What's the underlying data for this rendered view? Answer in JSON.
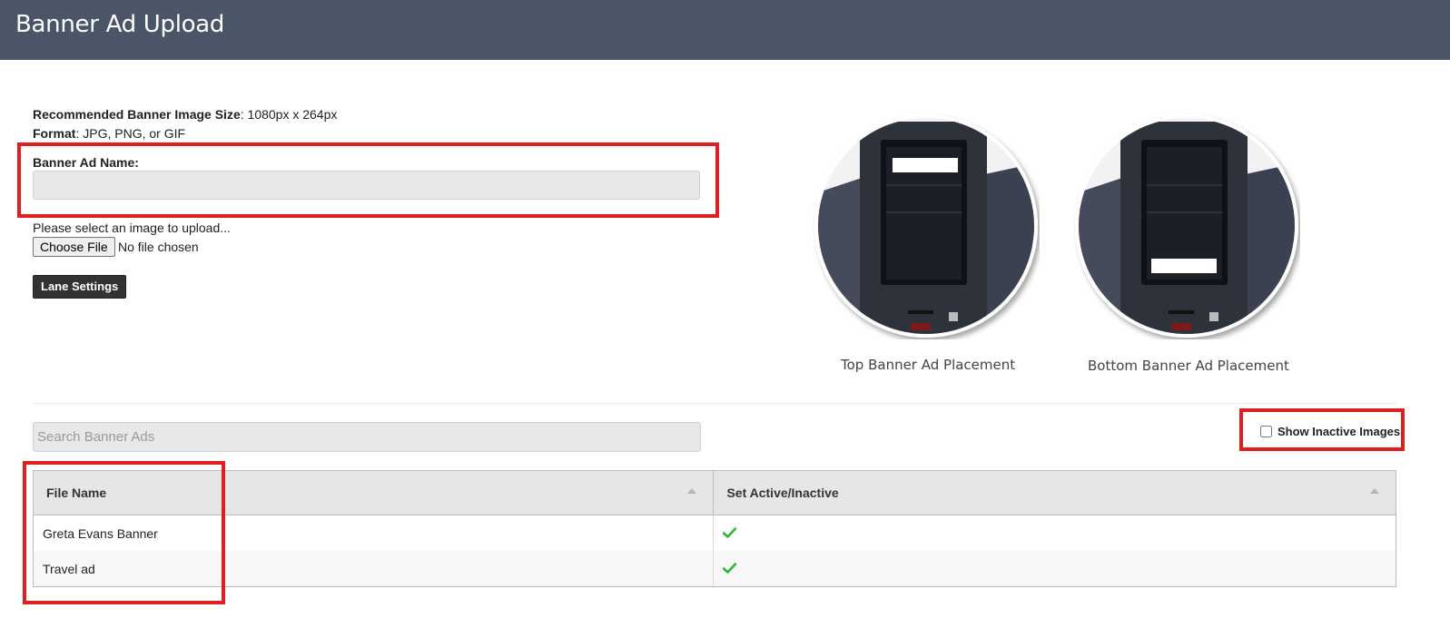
{
  "header": {
    "title": "Banner Ad Upload"
  },
  "info": {
    "size_label": "Recommended Banner Image Size",
    "size_value": ": 1080px x 264px",
    "format_label": "Format",
    "format_value": ": JPG, PNG, or GIF"
  },
  "form": {
    "name_label": "Banner Ad Name:",
    "name_value": "",
    "upload_prompt": "Please select an image to upload...",
    "choose_file_label": "Choose File",
    "file_status": "No file chosen",
    "lane_settings_label": "Lane Settings"
  },
  "placements": [
    {
      "caption": "Top Banner Ad Placement"
    },
    {
      "caption": "Bottom Banner Ad Placement"
    }
  ],
  "list": {
    "search_placeholder": "Search Banner Ads",
    "show_inactive_label": "Show Inactive Images",
    "show_inactive_checked": false,
    "columns": [
      "File Name",
      "Set Active/Inactive"
    ],
    "rows": [
      {
        "file_name": "Greta Evans Banner",
        "active": true
      },
      {
        "file_name": "Travel ad",
        "active": true
      }
    ]
  },
  "colors": {
    "header_bg": "#4a5568",
    "highlight": "#e02020",
    "check": "#2eb82e"
  }
}
